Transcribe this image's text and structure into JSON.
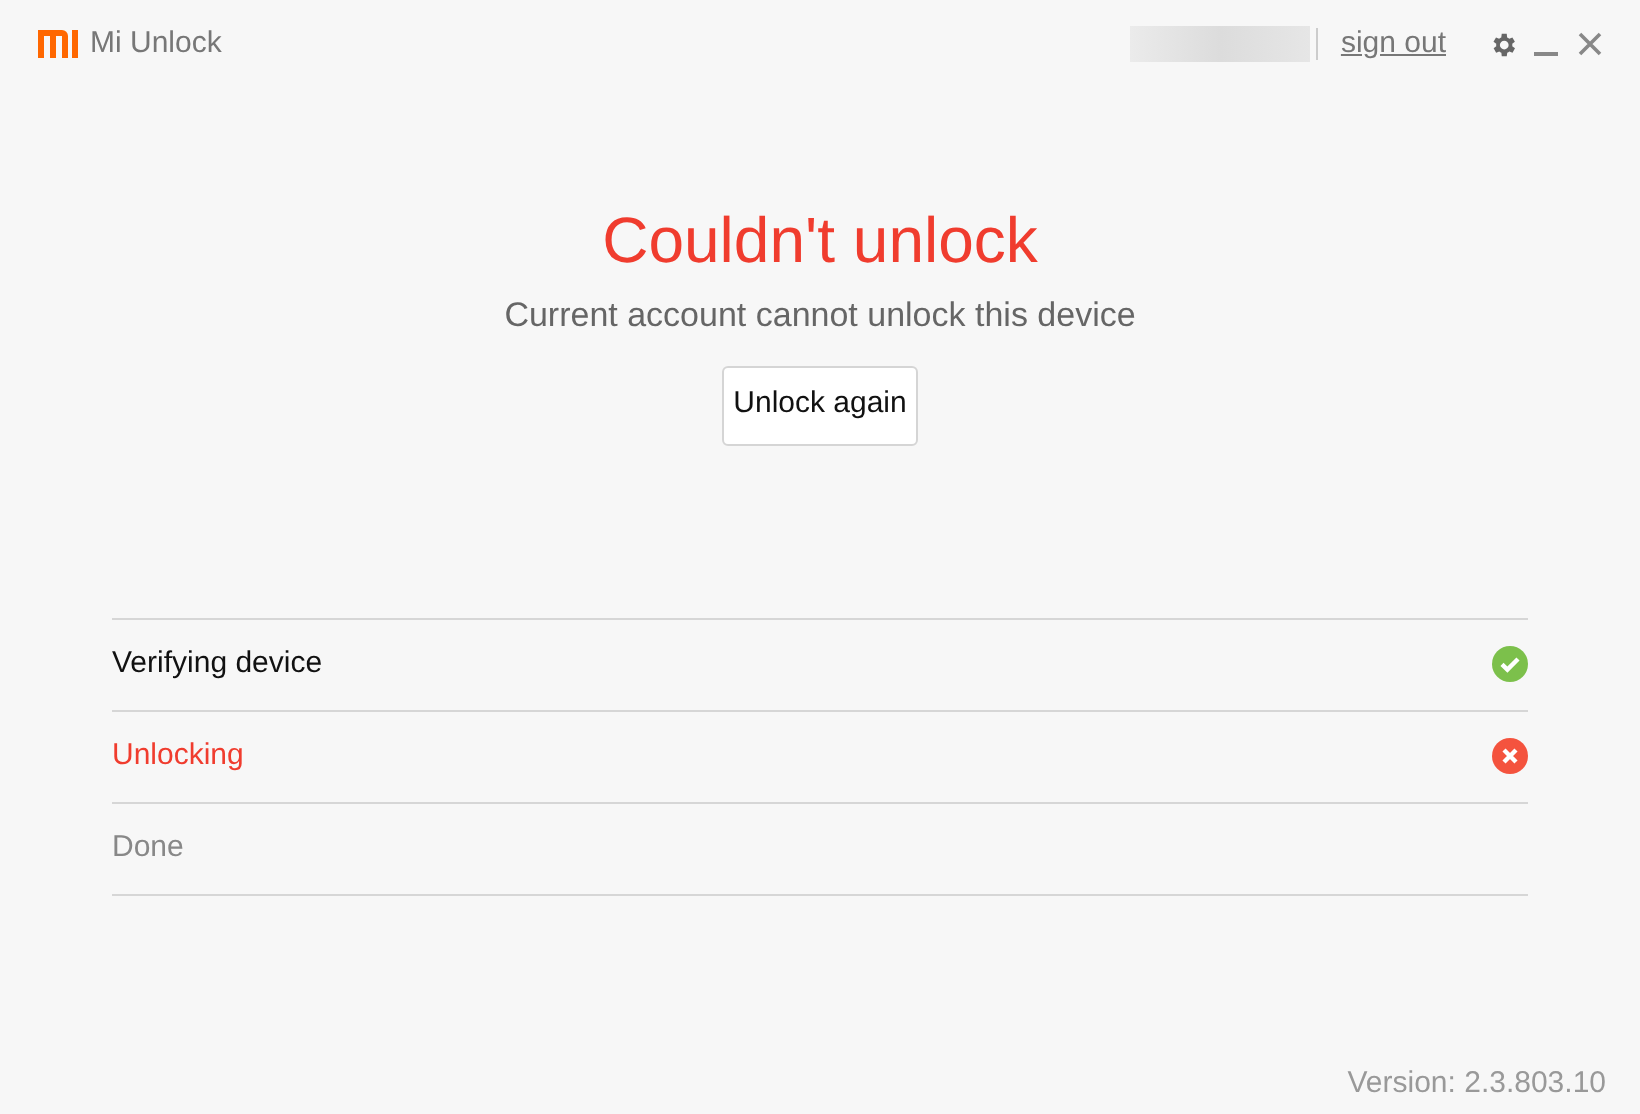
{
  "window": {
    "title": "Mi Unlock"
  },
  "header": {
    "sign_out": "sign out"
  },
  "result": {
    "title": "Couldn't unlock",
    "message": "Current account cannot unlock this device",
    "button": "Unlock again"
  },
  "steps": [
    {
      "label": "Verifying device",
      "kind": "done"
    },
    {
      "label": "Unlocking",
      "kind": "failed"
    },
    {
      "label": "Done",
      "kind": "pending"
    }
  ],
  "version": "Version: 2.3.803.10"
}
